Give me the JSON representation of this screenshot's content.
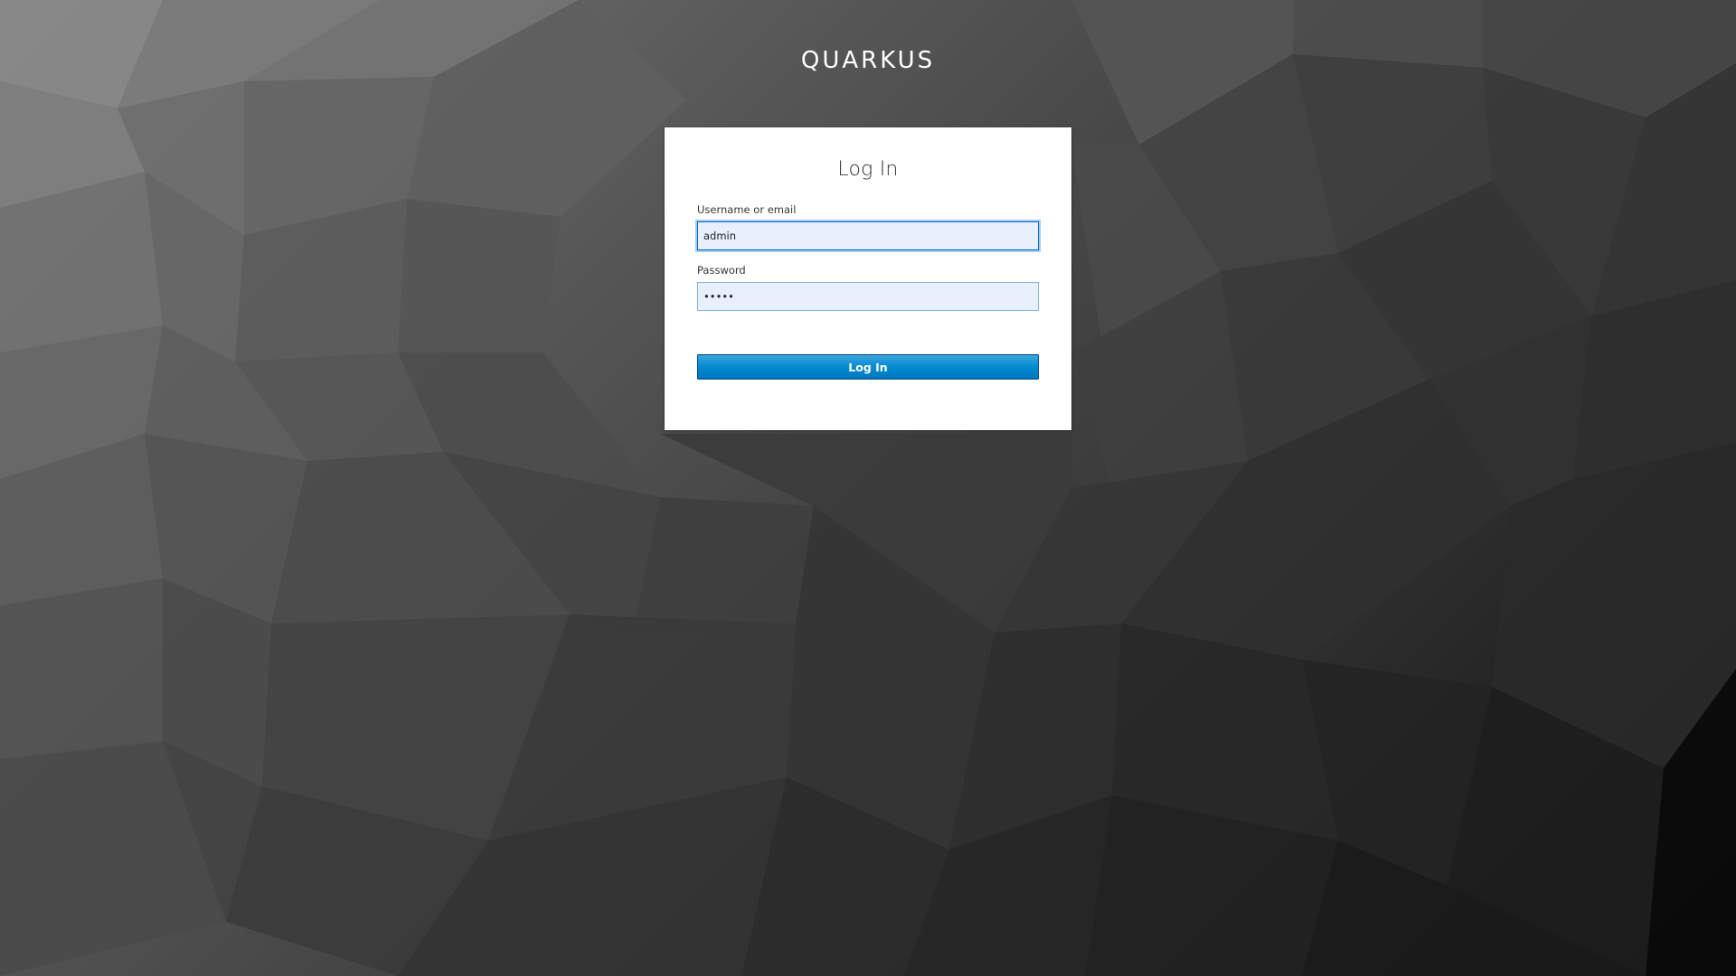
{
  "header": {
    "realm_name": "QUARKUS"
  },
  "login_form": {
    "title": "Log In",
    "username": {
      "label": "Username or email",
      "value": "admin"
    },
    "password": {
      "label": "Password",
      "value": "admin"
    },
    "submit_label": "Log In"
  },
  "colors": {
    "button_primary": "#0088ce",
    "input_autofill_bg": "#e8f0fe",
    "card_bg": "#ffffff"
  }
}
